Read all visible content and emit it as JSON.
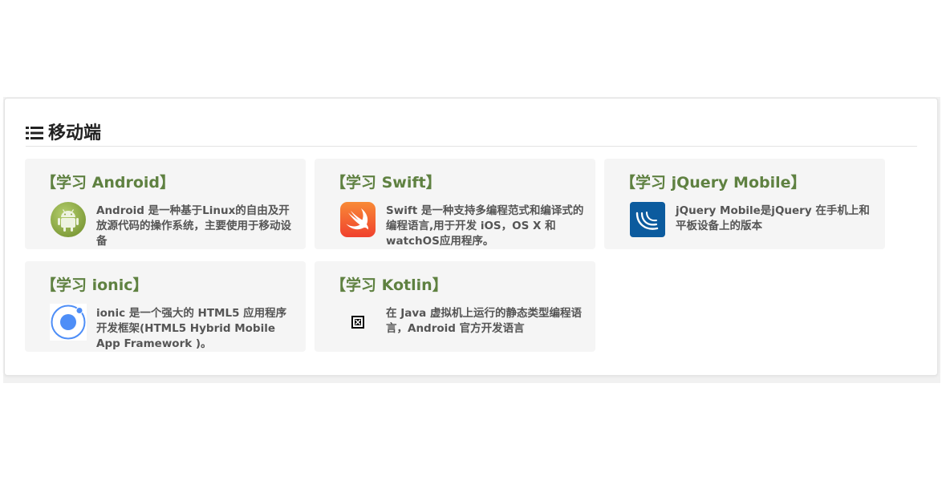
{
  "section": {
    "title": "移动端"
  },
  "cards": [
    {
      "title": "【学习 Android】",
      "desc": "Android 是一种基于Linux的自由及开放源代码的操作系统，主要使用于移动设备",
      "icon": "android-logo-icon"
    },
    {
      "title": "【学习 Swift】",
      "desc": "Swift 是一种支持多编程范式和编译式的编程语言,用于开发 iOS，OS X 和 watchOS应用程序。",
      "icon": "swift-logo-icon"
    },
    {
      "title": "【学习 jQuery Mobile】",
      "desc": "jQuery Mobile是jQuery 在手机上和平板设备上的版本",
      "icon": "jquery-mobile-logo-icon"
    },
    {
      "title": "【学习 ionic】",
      "desc": "ionic 是一个强大的 HTML5 应用程序开发框架(HTML5 Hybrid Mobile App Framework )。",
      "icon": "ionic-logo-icon"
    },
    {
      "title": "【学习 Kotlin】",
      "desc": "在 Java 虚拟机上运行的静态类型编程语言，Android 官方开发语言",
      "icon": "broken-image-icon"
    }
  ],
  "colors": {
    "card_title": "#5f8141",
    "card_background": "#f5f5f5",
    "description_text": "#555555"
  }
}
